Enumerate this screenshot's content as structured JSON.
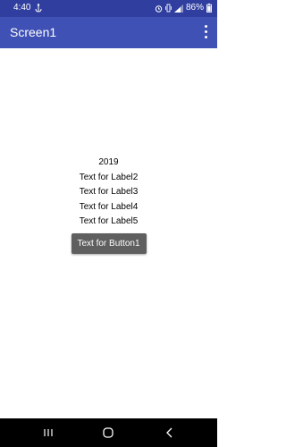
{
  "status_bar": {
    "time": "4:40",
    "battery": "86%",
    "background": "#303f9f",
    "left_icon": "usb-anchor-icon",
    "right_icons": [
      "alarm-icon",
      "vibrate-icon",
      "signal-icon",
      "battery-icon"
    ]
  },
  "app_bar": {
    "title": "Screen1",
    "background": "#3f51b5",
    "menu_icon": "overflow-menu-icon"
  },
  "main": {
    "labels": [
      "2019",
      "Text for Label2",
      "Text for Label3",
      "Text for Label4",
      "Text for Label5"
    ],
    "button": {
      "label": "Text for Button1",
      "background": "#5f5f5f"
    }
  },
  "nav_bar": {
    "background": "#000000",
    "buttons": [
      "recents-icon",
      "home-icon",
      "back-icon"
    ]
  }
}
